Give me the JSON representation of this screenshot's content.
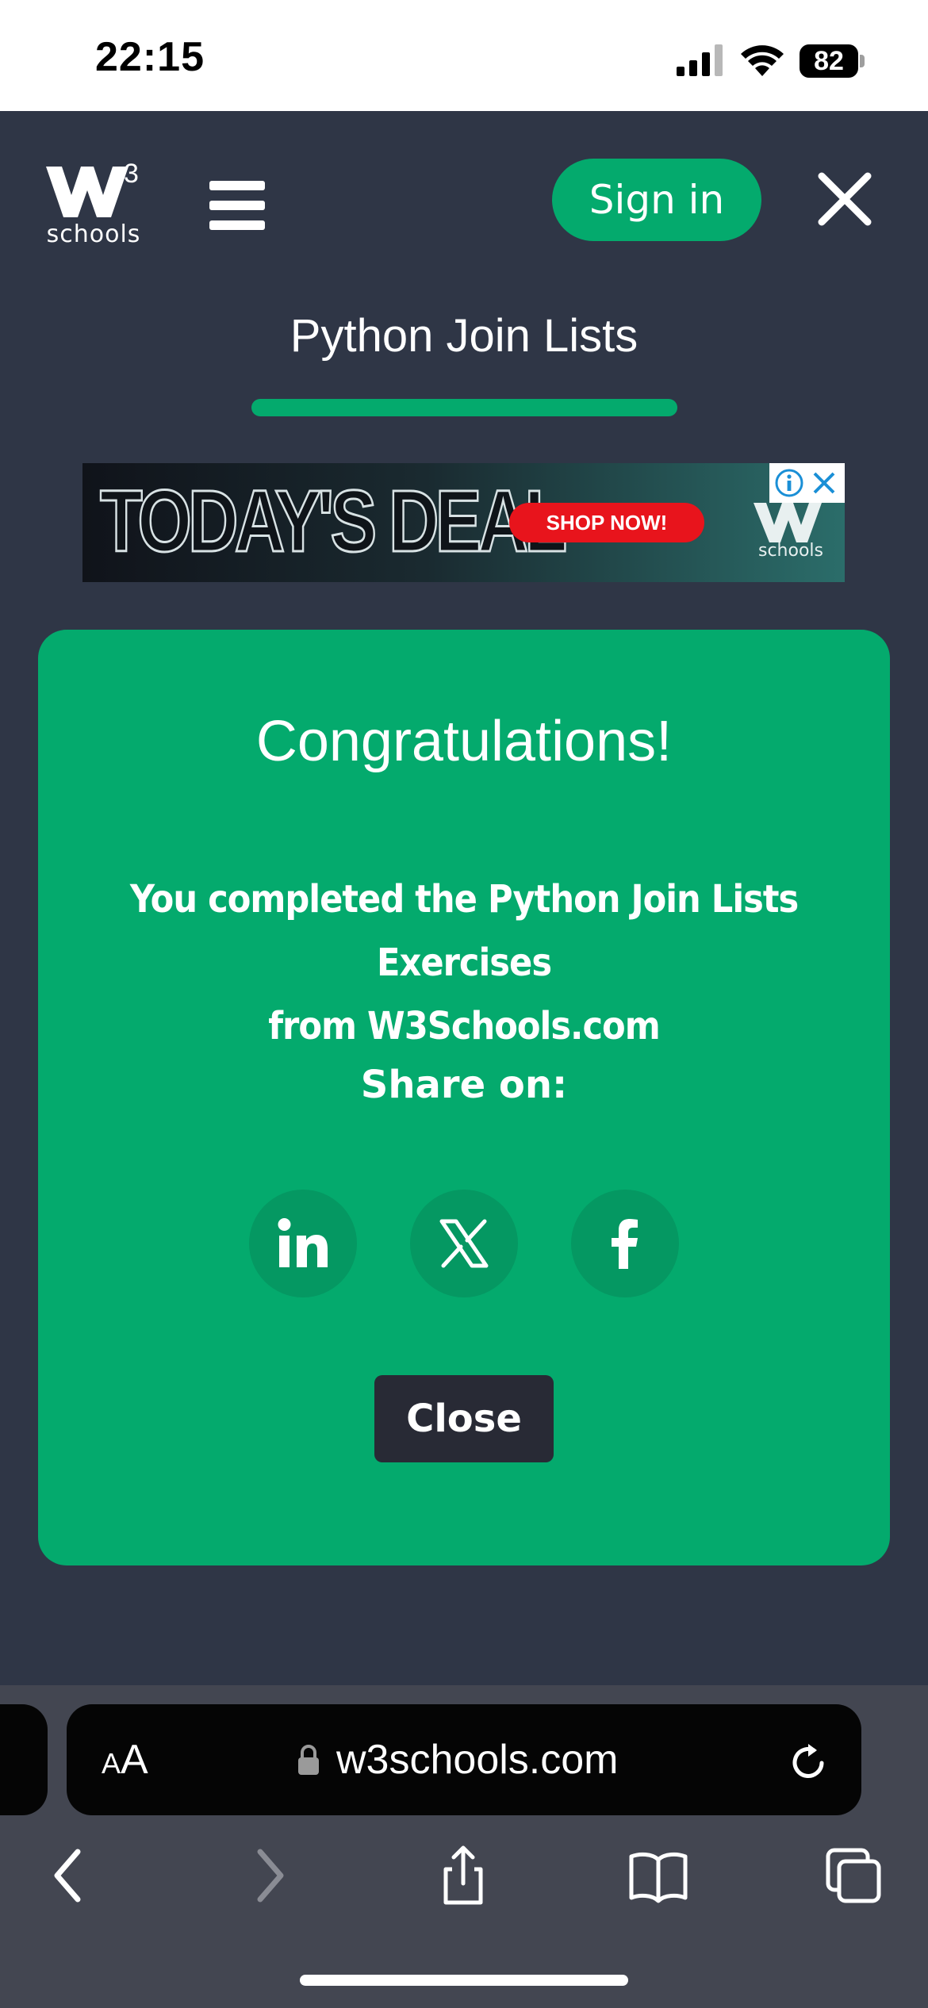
{
  "status_bar": {
    "time": "22:15",
    "battery": "82",
    "icons": [
      "cellular-signal-icon",
      "wifi-icon",
      "battery-icon"
    ]
  },
  "header": {
    "logo_text": "schools",
    "logo_superscript": "3",
    "menu_icon": "hamburger-menu-icon",
    "signin_label": "Sign in",
    "close_icon": "close-icon"
  },
  "page": {
    "title": "Python Join Lists"
  },
  "ad": {
    "headline": "TODAY'S DEAL",
    "cta": "SHOP NOW!",
    "logo_text": "schools",
    "icons": [
      "adchoices-info-icon",
      "ad-close-icon"
    ]
  },
  "card": {
    "heading": "Congratulations!",
    "message_line1": "You completed the Python Join Lists Exercises",
    "message_line2": "from W3Schools.com",
    "share_label": "Share on:",
    "social": [
      "linkedin-icon",
      "x-twitter-icon",
      "facebook-icon"
    ],
    "close_label": "Close"
  },
  "browser": {
    "text_size_small": "A",
    "text_size_big": "A",
    "url": "w3schools.com",
    "nav_icons": [
      "back-icon",
      "forward-icon",
      "share-icon",
      "bookmarks-icon",
      "tabs-icon"
    ]
  },
  "colors": {
    "accent": "#04aa6d",
    "page_bg": "#2f3646",
    "dark": "#282a35"
  }
}
